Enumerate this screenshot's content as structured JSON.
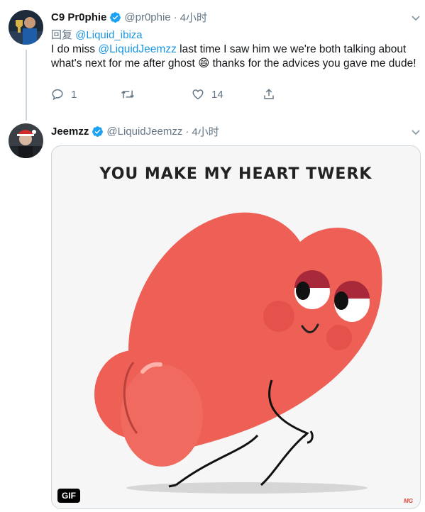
{
  "tweet1": {
    "display_name": "C9 Pr0phie",
    "handle": "@pr0phie",
    "separator": "·",
    "time": "4小时",
    "reply_prefix": "回复",
    "reply_to": "@Liquid_ibiza",
    "text_before": "I do miss ",
    "mention": "@LiquidJeemzz",
    "text_after": " last time I saw him we we're both talking about what's next for me after ghost 😄 thanks for the advices you gave me dude!",
    "reply_count": "1",
    "retweet_count": "",
    "like_count": "14"
  },
  "tweet2": {
    "display_name": "Jeemzz",
    "handle": "@LiquidJeemzz",
    "separator": "·",
    "time": "4小时",
    "gif_caption": "YOU MAKE MY HEART TWERK",
    "gif_badge": "GIF",
    "watermark": "MG"
  },
  "colors": {
    "link": "#1b95e0",
    "muted": "#657786",
    "verified": "#1da1f2",
    "heart": "#ee5f55"
  },
  "icons": [
    "verified-badge-icon",
    "chevron-down-icon",
    "reply-icon",
    "retweet-icon",
    "like-icon",
    "share-icon"
  ]
}
